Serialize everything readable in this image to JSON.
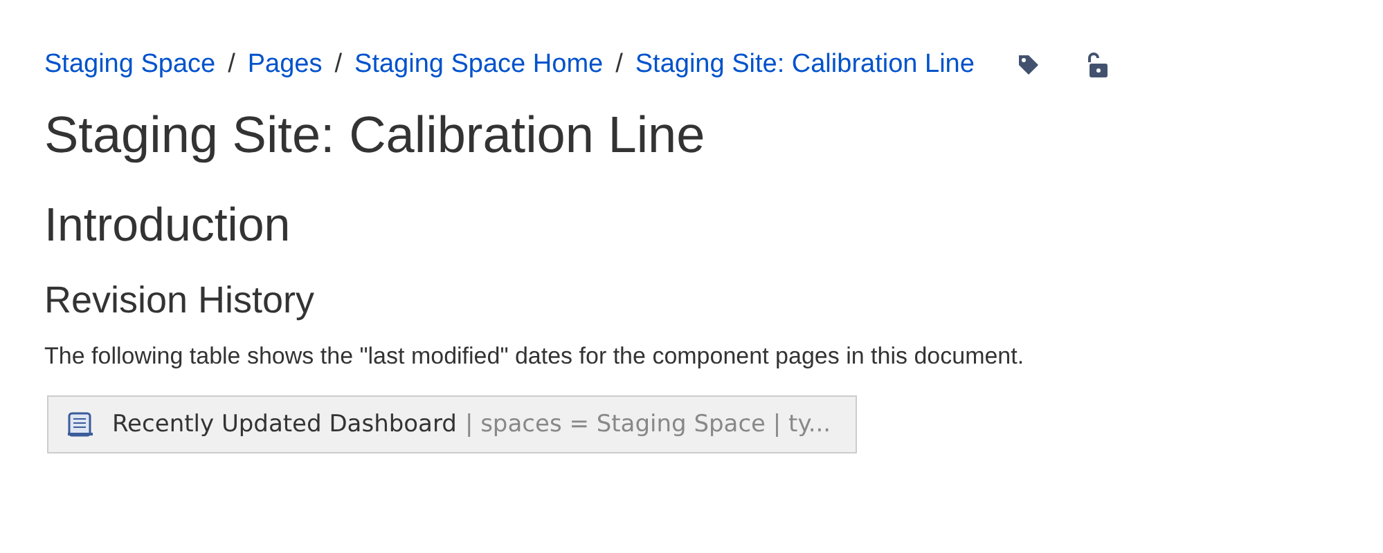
{
  "breadcrumbs": [
    "Staging Space",
    "Pages",
    "Staging Space Home",
    "Staging Site: Calibration Line"
  ],
  "breadcrumb_separator": "/",
  "title": "Staging Site: Calibration Line",
  "headings": [
    {
      "kind": "h2",
      "text": "Introduction"
    },
    {
      "kind": "h3",
      "text": "Revision History"
    }
  ],
  "paragraph": "The following table shows the \"last modified\" dates for the component pages in this document.",
  "macro": {
    "name": "Recently Updated Dashboard",
    "params": "| spaces = Staging Space | ty..."
  }
}
